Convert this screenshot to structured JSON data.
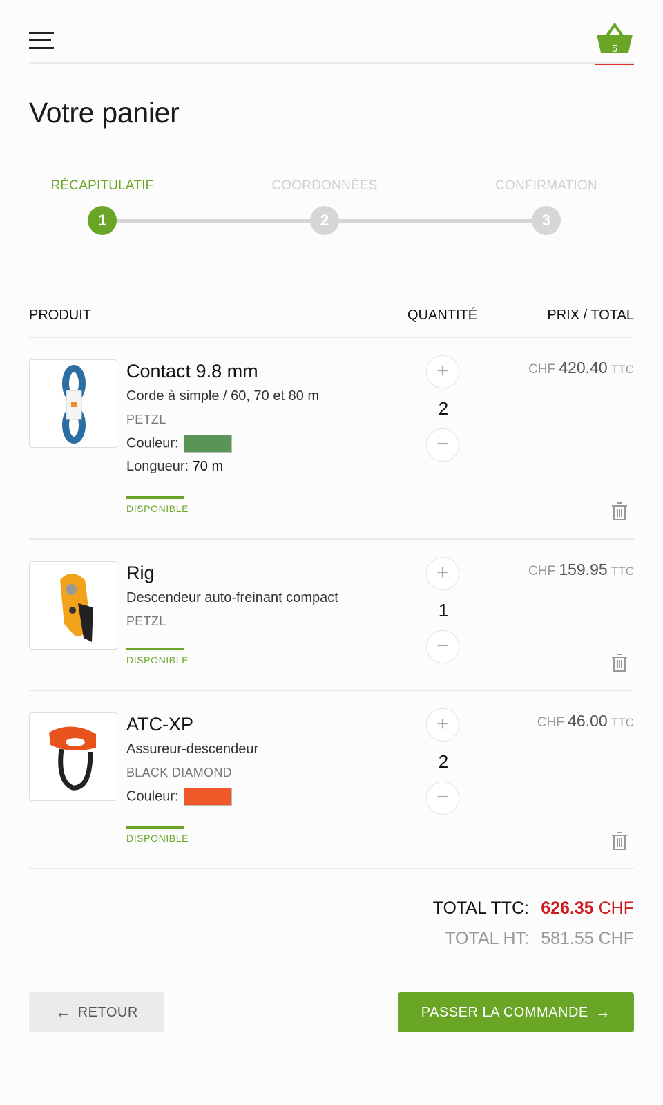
{
  "header": {
    "basket_count": "5"
  },
  "page_title": "Votre panier",
  "steps": [
    {
      "label": "RÉCAPITULATIF",
      "num": "1"
    },
    {
      "label": "COORDONNÉES",
      "num": "2"
    },
    {
      "label": "CONFIRMATION",
      "num": "3"
    }
  ],
  "table": {
    "col_product": "PRODUIT",
    "col_qty": "QUANTITÉ",
    "col_price": "PRIX / TOTAL"
  },
  "items": [
    {
      "name": "Contact 9.8 mm",
      "description": "Corde à simple / 60, 70 et 80 m",
      "brand": "PETZL",
      "color_label": "Couleur:",
      "color": "#5a9555",
      "length_label": "Longueur:",
      "length_value": "70 m",
      "availability": "DISPONIBLE",
      "quantity": "2",
      "currency": "CHF",
      "price": "420.40",
      "tax": "TTC"
    },
    {
      "name": "Rig",
      "description": "Descendeur auto-freinant compact",
      "brand": "PETZL",
      "availability": "DISPONIBLE",
      "quantity": "1",
      "currency": "CHF",
      "price": "159.95",
      "tax": "TTC"
    },
    {
      "name": "ATC-XP",
      "description": "Assureur-descendeur",
      "brand": "BLACK DIAMOND",
      "color_label": "Couleur:",
      "color": "#f05a2a",
      "availability": "DISPONIBLE",
      "quantity": "2",
      "currency": "CHF",
      "price": "46.00",
      "tax": "TTC"
    }
  ],
  "totals": {
    "ttc_label": "TOTAL TTC:",
    "ttc_amount": "626.35",
    "ttc_currency": "CHF",
    "ht_label": "TOTAL HT:",
    "ht_value": "581.55 CHF"
  },
  "buttons": {
    "back": "RETOUR",
    "order": "PASSER LA COMMANDE"
  },
  "colors": {
    "accent": "#6aa626",
    "total": "#cc1b1b",
    "inactive_step": "#d6d6d6"
  },
  "icons": [
    "menu-icon",
    "basket-icon",
    "plus-icon",
    "minus-icon",
    "trash-icon",
    "arrow-left-icon",
    "arrow-right-icon"
  ]
}
